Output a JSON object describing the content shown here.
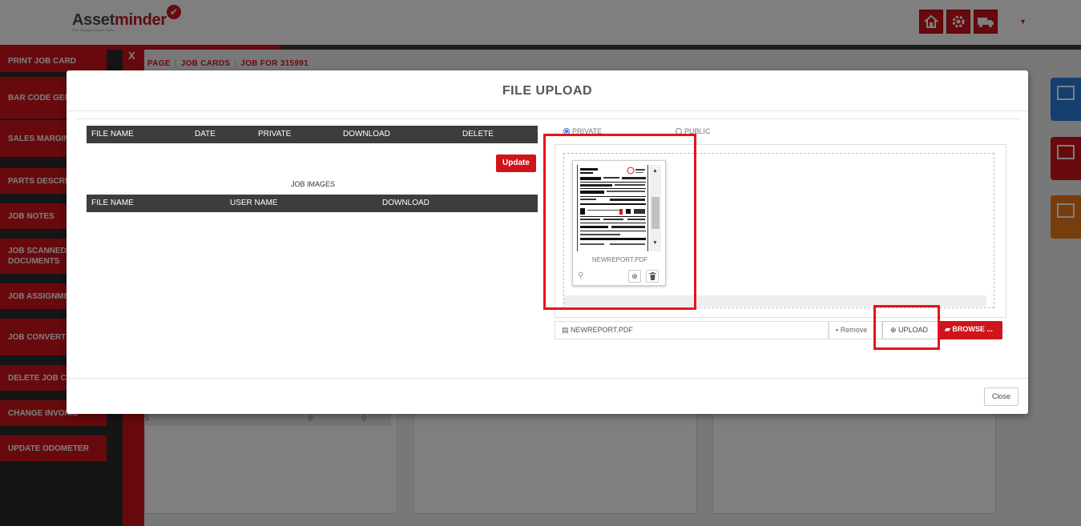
{
  "app": {
    "logo_prefix": "Asset",
    "logo_suffix": "minder",
    "logo_check": "✔",
    "tagline": "Plan. Manage. Record. Share.",
    "top_icons": [
      "home-icon",
      "gear-icon",
      "truck-icon"
    ],
    "caret": "▾"
  },
  "sidebar": {
    "close": "X",
    "items": [
      {
        "label": "PRINT JOB CARD"
      },
      {
        "label": "BAR CODE GEN"
      },
      {
        "label": "SALES MARGIN REPORT"
      },
      {
        "label": "PARTS DESCRI"
      },
      {
        "label": "JOB NOTES"
      },
      {
        "label": "JOB SCANNED DOCUMENTS"
      },
      {
        "label": "JOB ASSIGNME"
      },
      {
        "label": "JOB CONVERT WAN"
      },
      {
        "label": "DELETE JOB CA"
      },
      {
        "label": "CHANGE INVOICE"
      },
      {
        "label": "UPDATE ODOMETER"
      }
    ]
  },
  "breadcrumb": {
    "items": [
      "PAGE",
      "JOB CARDS",
      "JOB FOR 315991"
    ],
    "separator": "|"
  },
  "background_row": {
    "label": "S",
    "v1": "0",
    "v2": "0"
  },
  "modal": {
    "title": "FILE UPLOAD",
    "files_table": {
      "headers": [
        "FILE NAME",
        "DATE",
        "PRIVATE",
        "DOWNLOAD",
        "DELETE"
      ]
    },
    "update_label": "Update",
    "job_images_title": "JOB IMAGES",
    "images_table": {
      "headers": [
        "FILE NAME",
        "USER NAME",
        "DOWNLOAD"
      ]
    },
    "visibility": {
      "private_label": "PRIVATE",
      "public_label": "PUBLIC",
      "selected": "PRIVATE"
    },
    "preview": {
      "filename": "NEWREPORT.PDF",
      "pin_icon": "⚲",
      "zoom_icon": "⊕",
      "delete_icon": "🗑"
    },
    "file_input": {
      "caption": "NEWREPORT.PDF",
      "remove_label": "Remove",
      "upload_label": "UPLOAD",
      "browse_label": "BROWSE ..."
    },
    "close_label": "Close"
  },
  "colors": {
    "brand_red": "#d0141b",
    "highlight_red": "#e8121b",
    "table_header": "#3d3d3d",
    "radio_blue": "#2a7fe0"
  }
}
